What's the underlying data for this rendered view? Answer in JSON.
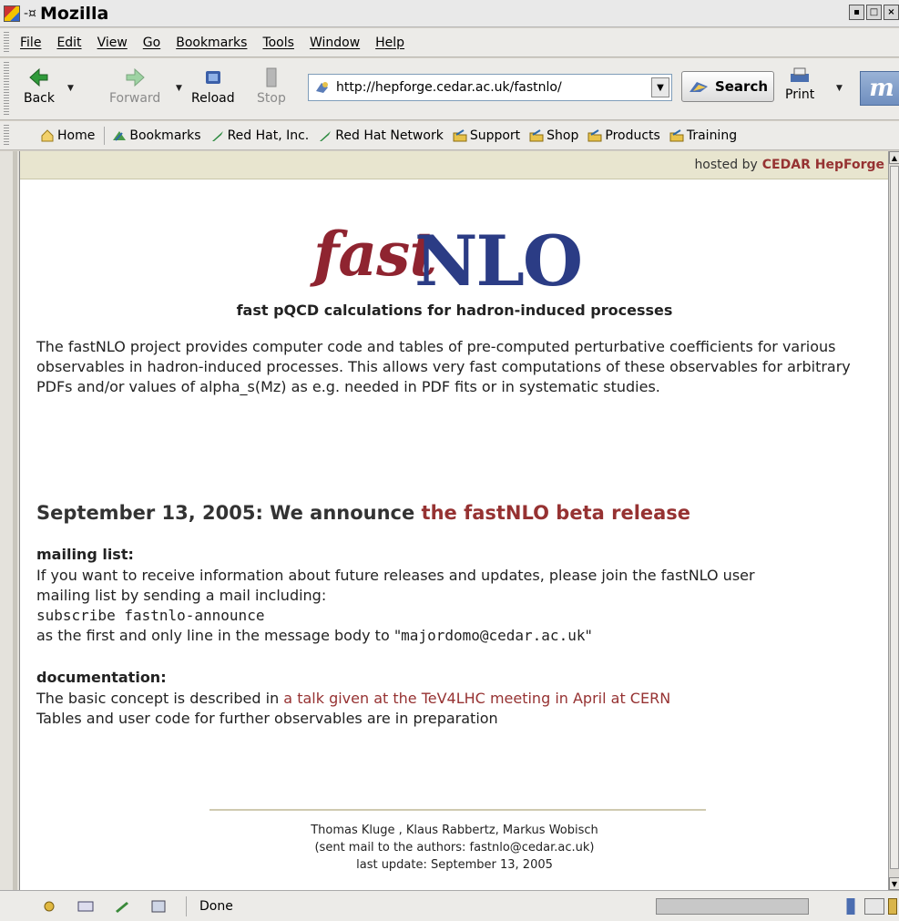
{
  "window": {
    "title": "Mozilla"
  },
  "menu": [
    "File",
    "Edit",
    "View",
    "Go",
    "Bookmarks",
    "Tools",
    "Window",
    "Help"
  ],
  "nav": {
    "back": "Back",
    "forward": "Forward",
    "reload": "Reload",
    "stop": "Stop",
    "url": "http://hepforge.cedar.ac.uk/fastnlo/",
    "search": "Search",
    "print": "Print"
  },
  "bookmarks": [
    "Home",
    "Bookmarks",
    "Red Hat, Inc.",
    "Red Hat Network",
    "Support",
    "Shop",
    "Products",
    "Training"
  ],
  "page": {
    "hosted_prefix": "hosted by",
    "hosted_link": "CEDAR HepForge",
    "logo_fast": "fast",
    "logo_nlo": "NLO",
    "tagline": "fast pQCD calculations for hadron-induced processes",
    "intro": "The fastNLO project provides computer code and tables of pre-computed perturbative coefficients for various observables in hadron-induced processes. This allows very fast computations of these observables for arbitrary PDFs and/or values of alpha_s(Mz) as e.g. needed in PDF fits or in systematic studies.",
    "announce_text": "September 13, 2005: We announce ",
    "announce_link": "the fastNLO beta release",
    "mailing_title": "mailing list:",
    "mailing_line1": "If you want to receive information about future releases and updates, please join the fastNLO user",
    "mailing_line2": "mailing list by sending a mail including:",
    "mailing_cmd": "subscribe fastnlo-announce",
    "mailing_line3a": "as the first and only line in the message body to \"",
    "mailing_email": "majordomo@cedar.ac.uk",
    "mailing_line3b": "\"",
    "doc_title": "documentation:",
    "doc_line1a": "The basic concept is described in ",
    "doc_link": "a talk given at the TeV4LHC meeting in April at CERN",
    "doc_line2": "Tables and user code for further observables are in preparation",
    "footer_authors": "Thomas Kluge , Klaus Rabbertz, Markus Wobisch",
    "footer_mail": "(sent mail to the authors: fastnlo@cedar.ac.uk)",
    "footer_update": "last update: September 13, 2005"
  },
  "status": {
    "text": "Done"
  }
}
